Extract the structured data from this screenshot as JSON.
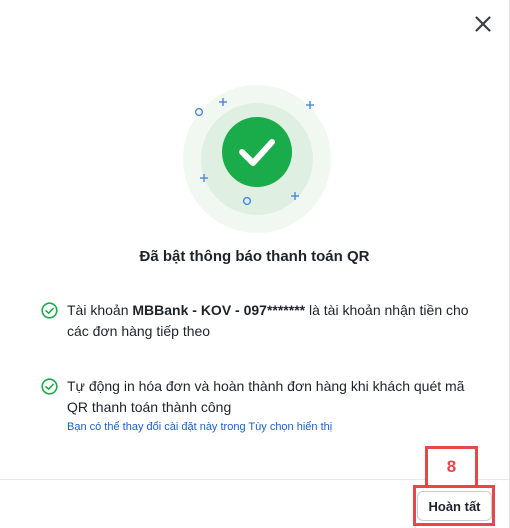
{
  "dialog": {
    "close_icon": "close-icon",
    "success_icon": "check-circle-icon",
    "title": "Đã bật thông báo thanh toán QR"
  },
  "items": [
    {
      "icon": "check-circle-outline-icon",
      "prefix": "Tài khoản ",
      "account": "MBBank - KOV - 097*******",
      "suffix": " là tài khoản nhận tiền cho các đơn hàng tiếp theo"
    },
    {
      "icon": "check-circle-outline-icon",
      "text": "Tự động in hóa đơn và hoàn thành đơn hàng khi khách quét mã QR thanh toán thành công",
      "link": "Bạn có thể thay đổi cài đặt này trong Tùy chọn hiển thị"
    }
  ],
  "footer": {
    "finish_label": "Hoàn tất"
  },
  "annotation": {
    "step_number": "8"
  },
  "colors": {
    "success_green": "#1aab4b",
    "light_green": "#eef7ef",
    "mid_green": "#d9eedd",
    "link_blue": "#1a5fd0",
    "annotation_red": "#e8474a"
  }
}
